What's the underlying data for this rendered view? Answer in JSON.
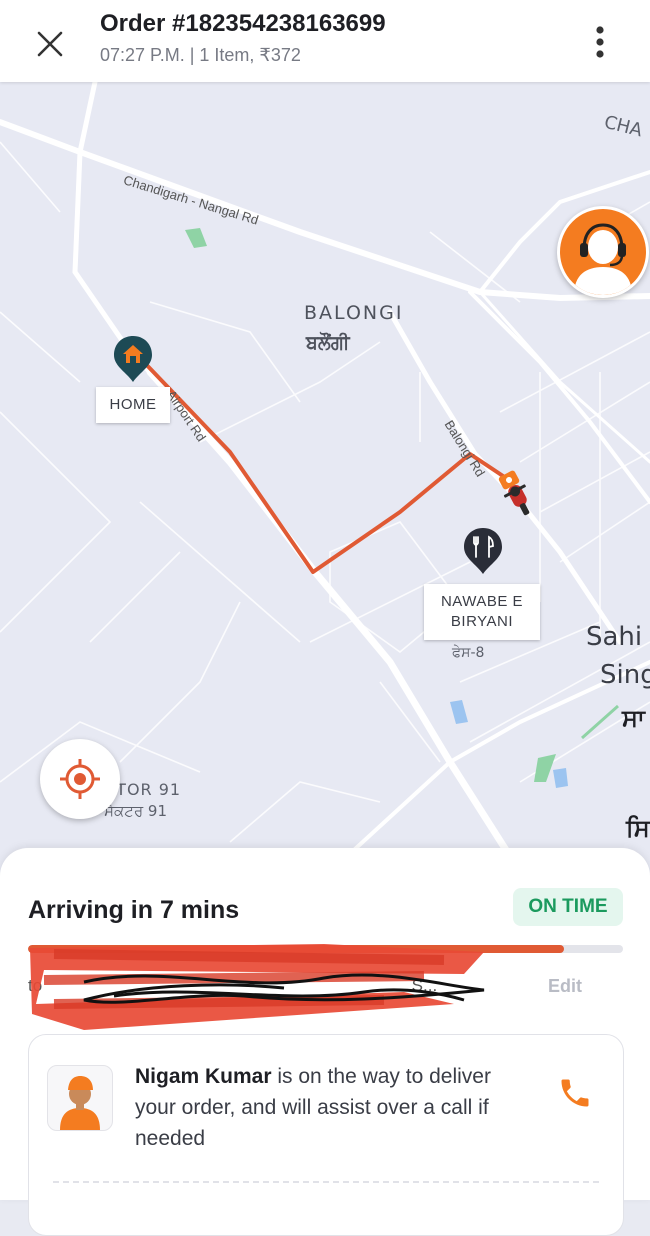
{
  "header": {
    "order_title": "Order #182354238163699",
    "order_subtitle": "07:27 P.M. | 1 Item, ₹372"
  },
  "map": {
    "labels": {
      "balongi": "BALONGI",
      "balongi_punjabi": "ਬਲੌਂਗੀ",
      "sector": "CTOR 91",
      "sector_punjabi": "ਸੈਕਟਰ 91",
      "sahi": "Sahi",
      "sing": "Sing",
      "sa_punjabi": "ਸਾ",
      "si_punjabi": "ਸਿ",
      "chandigarh_nangal": "Chandigarh - Nangal Rd",
      "airport_rd": "Airport Rd",
      "balongi_rd": "Balongi Rd",
      "cha": "CHA",
      "phase8": "ਫੇਸ-8"
    },
    "home_label": "HOME",
    "restaurant_label_line1": "NAWABE E",
    "restaurant_label_line2": "BIRYANI"
  },
  "sheet": {
    "arriving_text": "Arriving in 7 mins",
    "status_badge": "ON TIME",
    "progress": 0.9,
    "address_prefix": "to",
    "address_suffix": "S...",
    "edit_label": "Edit",
    "rider_name": "Nigam Kumar",
    "rider_message": " is on the way to deliver your order, and will assist over a call if needed"
  },
  "colors": {
    "accent": "#f47c20",
    "route": "#e05a34",
    "status_green": "#1b9a5e"
  },
  "icons": [
    "close-icon",
    "more-vertical-icon",
    "home-pin-icon",
    "restaurant-pin-icon",
    "delivery-scooter-icon",
    "support-agent-icon",
    "locate-icon",
    "phone-icon",
    "rider-avatar-icon"
  ]
}
